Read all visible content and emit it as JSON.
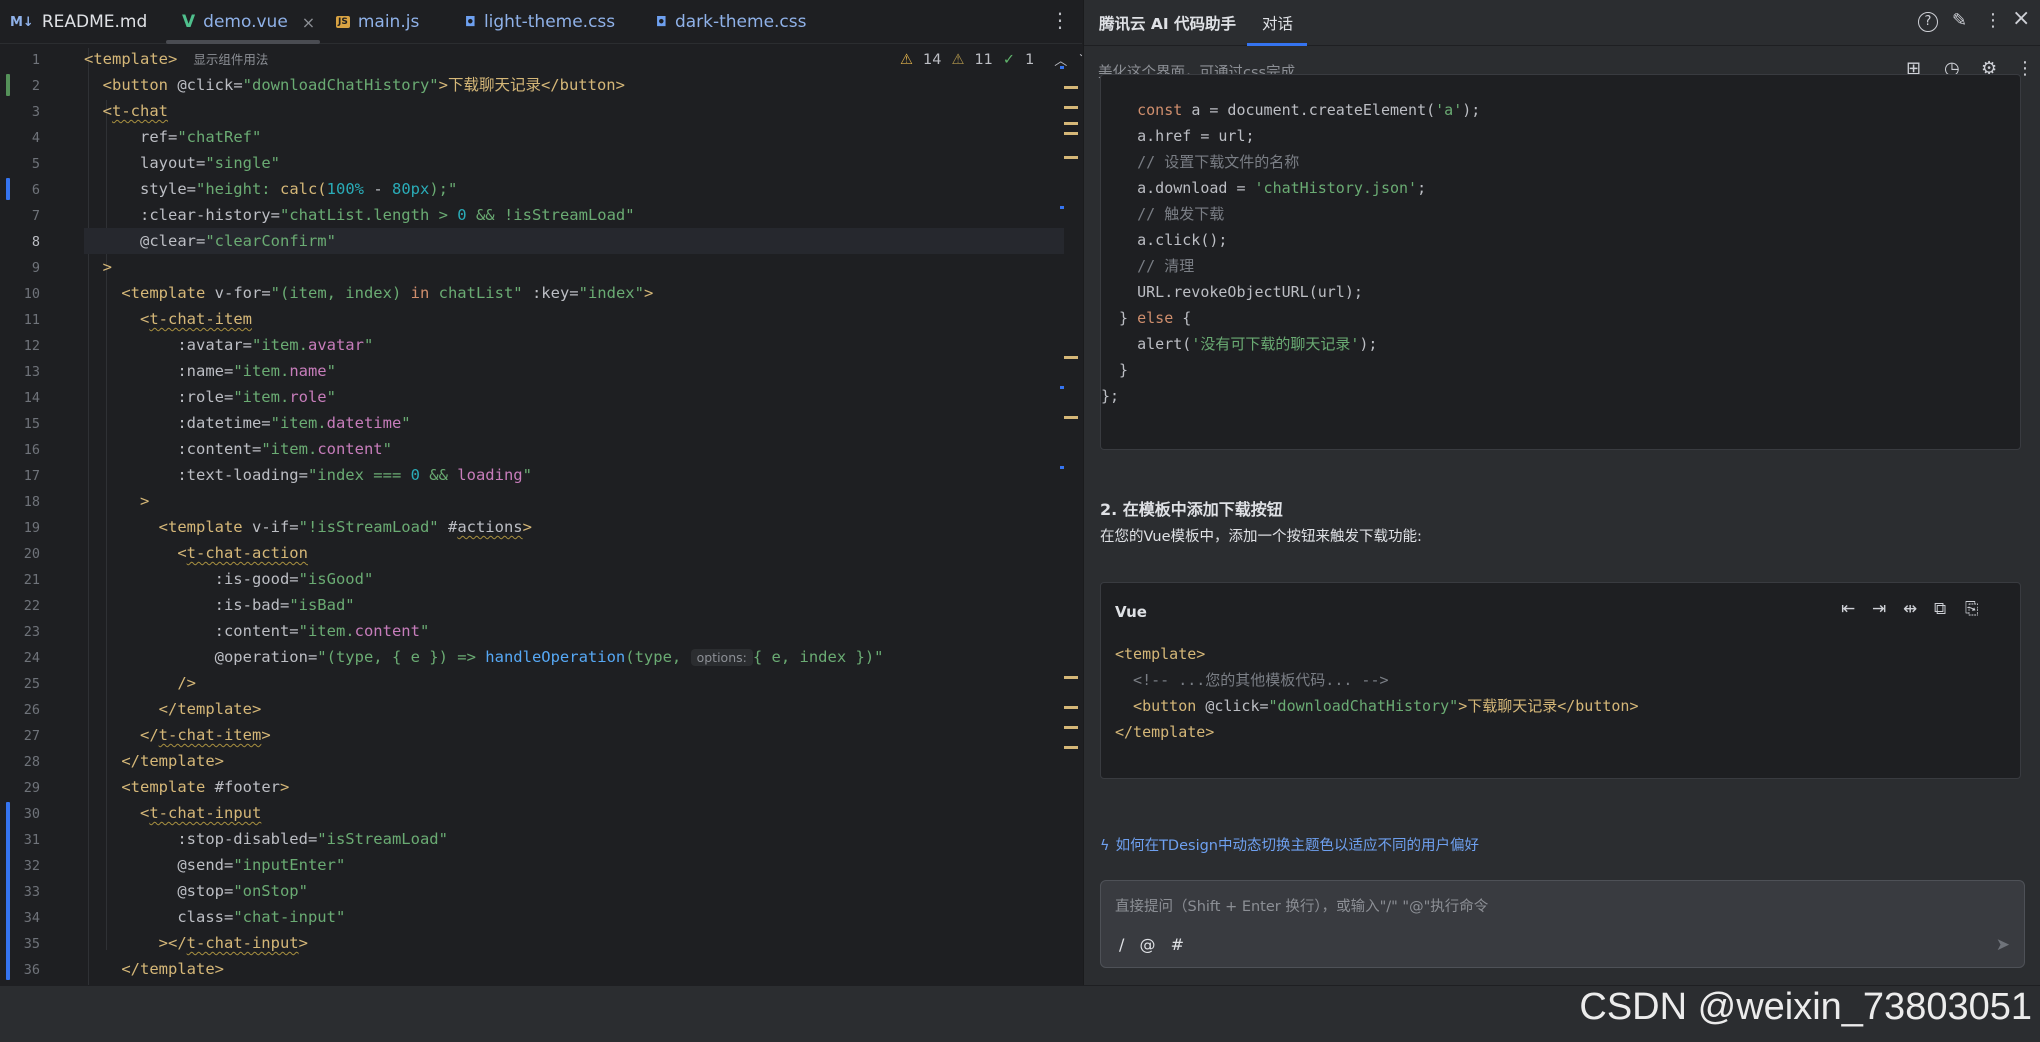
{
  "tabs": [
    {
      "label": "README.md",
      "icon": "markdown-icon",
      "icon_text": "M↓"
    },
    {
      "label": "demo.vue",
      "icon": "vue-icon",
      "icon_text": "V",
      "active": true
    },
    {
      "label": "main.js",
      "icon": "js-file-icon",
      "icon_text": "JS"
    },
    {
      "label": "light-theme.css",
      "icon": "css-file-icon",
      "icon_text": "◘"
    },
    {
      "label": "dark-theme.css",
      "icon": "css-file-icon",
      "icon_text": "◘"
    }
  ],
  "tab_close": "×",
  "tab_more": "⋮",
  "inspections": {
    "warnings": "14",
    "weak_warnings": "11",
    "ok": "1"
  },
  "template_hint": "显示组件用法",
  "param_hint": "options:",
  "line_numbers": [
    "1",
    "2",
    "3",
    "4",
    "5",
    "6",
    "7",
    "8",
    "9",
    "10",
    "11",
    "12",
    "13",
    "14",
    "15",
    "16",
    "17",
    "18",
    "19",
    "20",
    "21",
    "22",
    "23",
    "24",
    "25",
    "26",
    "27",
    "28",
    "29",
    "30",
    "31",
    "32",
    "33",
    "34",
    "35",
    "36"
  ],
  "code": {
    "l1": "<template>",
    "l2a": "  <button ",
    "l2b": "@click=",
    "l2c": "\"downloadChatHistory\"",
    "l2d": ">下载聊天记录</button>",
    "l3a": "  <",
    "l3b": "t-chat",
    "l4a": "      ref=",
    "l4b": "\"chatRef\"",
    "l5a": "      layout=",
    "l5b": "\"single\"",
    "l6a": "      style=",
    "l6b": "\"height: ",
    "l6c": "calc(",
    "l6d": "100%",
    "l6e": " - ",
    "l6f": "80px",
    "l6g": ");\"",
    "l7a": "      :clear-history=",
    "l7b": "\"chatList.length > ",
    "l7c": "0",
    "l7d": " && !isStreamLoad\"",
    "l8a": "      @clear=",
    "l8b": "\"clearConfirm\"",
    "l9": "  >",
    "l10a": "    <template ",
    "l10b": "v-for=",
    "l10c": "\"(item, index) ",
    "l10d": "in",
    "l10e": " chatList\"",
    "l10f": " :key=",
    "l10g": "\"index\"",
    "l10h": ">",
    "l11a": "      <",
    "l11b": "t-chat-item",
    "l12a": "          :avatar=",
    "l12b": "\"item.",
    "l12c": "avatar",
    "l12d": "\"",
    "l13a": "          :name=",
    "l13b": "\"item.",
    "l13c": "name",
    "l13d": "\"",
    "l14a": "          :role=",
    "l14b": "\"item.",
    "l14c": "role",
    "l14d": "\"",
    "l15a": "          :datetime=",
    "l15b": "\"item.",
    "l15c": "datetime",
    "l15d": "\"",
    "l16a": "          :content=",
    "l16b": "\"item.",
    "l16c": "content",
    "l16d": "\"",
    "l17a": "          :text-loading=",
    "l17b": "\"index === ",
    "l17c": "0",
    "l17d": " && ",
    "l17e": "loading",
    "l17f": "\"",
    "l18": "      >",
    "l19a": "        <template ",
    "l19b": "v-if=",
    "l19c": "\"!isStreamLoad\"",
    "l19d": " #",
    "l19e": "actions",
    "l19f": ">",
    "l20a": "          <",
    "l20b": "t-chat-action",
    "l21a": "              :is-good=",
    "l21b": "\"isGood\"",
    "l22a": "              :is-bad=",
    "l22b": "\"isBad\"",
    "l23a": "              :content=",
    "l23b": "\"item.",
    "l23c": "content",
    "l23d": "\"",
    "l24a": "              @operation=",
    "l24b": "\"(type, { e }) => ",
    "l24c": "handleOperation",
    "l24d": "(type, ",
    "l24e": "{ e, index })\"",
    "l25": "          />",
    "l26": "        </template>",
    "l27a": "      </",
    "l27b": "t-chat-item",
    "l27c": ">",
    "l28": "    </template>",
    "l29a": "    <template ",
    "l29b": "#footer",
    "l29c": ">",
    "l30a": "      <",
    "l30b": "t-chat-input",
    "l31a": "          :stop-disabled=",
    "l31b": "\"isStreamLoad\"",
    "l32a": "          @send=",
    "l32b": "\"inputEnter\"",
    "l33a": "          @stop=",
    "l33b": "\"onStop\"",
    "l34a": "          class=",
    "l34b": "\"chat-input\"",
    "l35a": "        ></",
    "l35b": "t-chat-input",
    "l35c": ">",
    "l36": "    </template>"
  },
  "panel": {
    "title": "腾讯云 AI 代码助手",
    "tab": "对话",
    "header_icons": [
      "help-icon",
      "edit-icon",
      "more-icon",
      "close-icon"
    ],
    "header_icon_glyphs": [
      "?",
      "✎",
      "⋮",
      "×"
    ],
    "subtitle": "美化这个界面，可通过css完成",
    "sub_icons": [
      "new-chat-icon",
      "history-icon",
      "robot-icon",
      "more-icon"
    ],
    "sub_icon_glyphs": [
      "⊞",
      "◷",
      "⚙",
      "⋮"
    ],
    "code1": {
      "l1a": "    const ",
      "l1b": "a = document.createElement(",
      "l1c": "'a'",
      "l1d": ");",
      "l2": "    a.href = url;",
      "l3": "    // 设置下载文件的名称",
      "l4a": "    a.download = ",
      "l4b": "'chatHistory.json'",
      "l4c": ";",
      "l5": "    // 触发下载",
      "l6": "    a.click();",
      "l7": "    // 清理",
      "l8": "    URL.revokeObjectURL(url);",
      "l9a": "  } ",
      "l9b": "else",
      "l9c": " {",
      "l10a": "    alert(",
      "l10b": "'没有可下载的聊天记录'",
      "l10c": ");",
      "l11": "  }",
      "l12": "};"
    },
    "section_title": "2. 在模板中添加下载按钮",
    "section_desc": "在您的Vue模板中，添加一个按钮来触发下载功能:",
    "code2": {
      "lang": "Vue",
      "icons": [
        "insert-left-icon",
        "insert-right-icon",
        "diff-icon",
        "copy-icon",
        "new-file-icon"
      ],
      "icon_glyphs": [
        "⇤",
        "⇥",
        "⇹",
        "⧉",
        "⎘"
      ],
      "l1": "<template>",
      "l2": "  <!-- ...您的其他模板代码... -->",
      "l3a": "  <button ",
      "l3b": "@click=",
      "l3c": "\"downloadChatHistory\"",
      "l3d": ">下载聊天记录</button>",
      "l4": "</template>"
    },
    "suggestion": "如何在TDesign中动态切换主题色以适应不同的用户偏好",
    "input_placeholder": "直接提问（Shift + Enter 换行），或输入\"/\" \"@\"执行命令",
    "input_tools": "/ @ #",
    "send_icon": "➤"
  },
  "watermark": "CSDN @weixin_73803051",
  "colors": {
    "tag": "#d5b778",
    "string": "#6aab73",
    "number": "#2aacb8",
    "keyword": "#cf8e6d",
    "function": "#56a8f5",
    "property": "#c77dbb",
    "accent": "#3574f0"
  }
}
